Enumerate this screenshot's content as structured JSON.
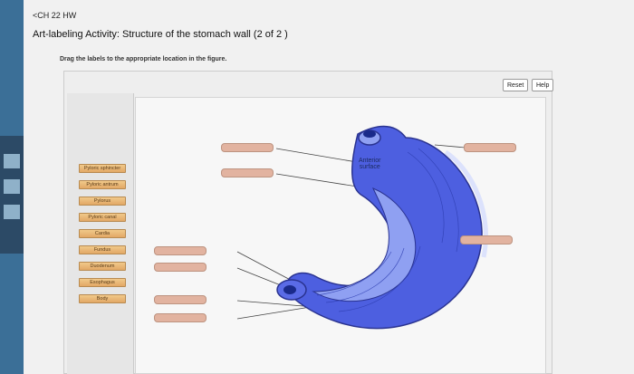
{
  "header": {
    "back_link": "<CH 22 HW",
    "title": "Art-labeling Activity: Structure of the stomach wall (2 of 2 )"
  },
  "activity": {
    "instruction": "Drag the labels to the appropriate location in the figure.",
    "reset_label": "Reset",
    "help_label": "Help"
  },
  "label_bank": [
    "Pyloric sphincter",
    "Pyloric antrum",
    "Pylorus",
    "Pyloric canal",
    "Cardia",
    "Fundus",
    "Duodenum",
    "Esophagus",
    "Body"
  ],
  "figure": {
    "annotation_line1": "Anterior",
    "annotation_line2": "surface",
    "colors": {
      "stomach": "#4d5fe0",
      "stomach_light": "#8fa0f2",
      "drop_target": "#e2b3a0"
    }
  }
}
